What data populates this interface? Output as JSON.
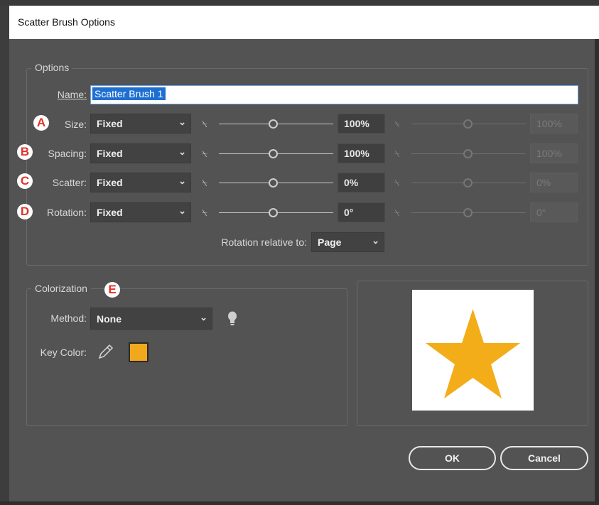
{
  "window": {
    "title": "Scatter Brush Options"
  },
  "options_group": {
    "legend": "Options",
    "name": {
      "label": "Name:",
      "value": "Scatter Brush 1"
    },
    "rows": [
      {
        "badge": "A",
        "label": "Size:",
        "mode": "Fixed",
        "value1": "100%",
        "value2": "100%"
      },
      {
        "badge": "B",
        "label": "Spacing:",
        "mode": "Fixed",
        "value1": "100%",
        "value2": "100%"
      },
      {
        "badge": "C",
        "label": "Scatter:",
        "mode": "Fixed",
        "value1": "0%",
        "value2": "0%"
      },
      {
        "badge": "D",
        "label": "Rotation:",
        "mode": "Fixed",
        "value1": "0°",
        "value2": "0°"
      }
    ],
    "rotation_relative": {
      "label": "Rotation relative to:",
      "value": "Page"
    }
  },
  "colorization": {
    "legend": "Colorization",
    "badge": "E",
    "method": {
      "label": "Method:",
      "value": "None"
    },
    "key_color": {
      "label": "Key Color:",
      "color": "#f2a81d"
    }
  },
  "preview": {
    "shape": "star-icon",
    "color": "#f2ad19"
  },
  "buttons": {
    "ok": "OK",
    "cancel": "Cancel"
  }
}
